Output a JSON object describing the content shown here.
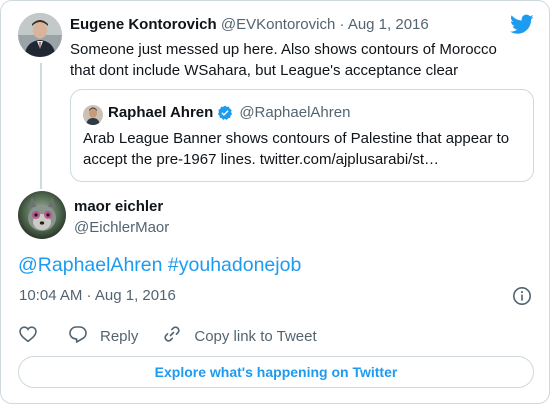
{
  "colors": {
    "accent": "#1d9bf0",
    "muted": "#536471",
    "text": "#0f1419",
    "border": "#cfd9de"
  },
  "parent_tweet": {
    "author_name": "Eugene Kontorovich",
    "handle": "@EVKontorovich",
    "separator": " · ",
    "date": "Aug 1, 2016",
    "text": "Someone just messed up here. Also shows contours of Morocco that dont include WSahara, but League's acceptance clear",
    "quoted": {
      "author_name": "Raphael Ahren",
      "verified_icon": "verified-badge-icon",
      "handle": "@RaphaelAhren",
      "text": "Arab League Banner shows contours of Palestine that appear to accept the pre-1967 lines. twitter.com/ajplusarabi/st…"
    }
  },
  "main_tweet": {
    "author_name": "maor eichler",
    "handle": "@EichlerMaor",
    "mention": "@RaphaelAhren",
    "hashtag": "#youhadonejob",
    "timestamp": "10:04 AM · Aug 1, 2016",
    "info_icon": "info-icon"
  },
  "actions": {
    "like_icon": "heart-icon",
    "reply_label": "Reply",
    "reply_icon": "reply-icon",
    "copy_label": "Copy link to Tweet",
    "copy_icon": "link-icon"
  },
  "explore_label": "Explore what's happening on Twitter",
  "brand_icon": "twitter-bird-icon"
}
